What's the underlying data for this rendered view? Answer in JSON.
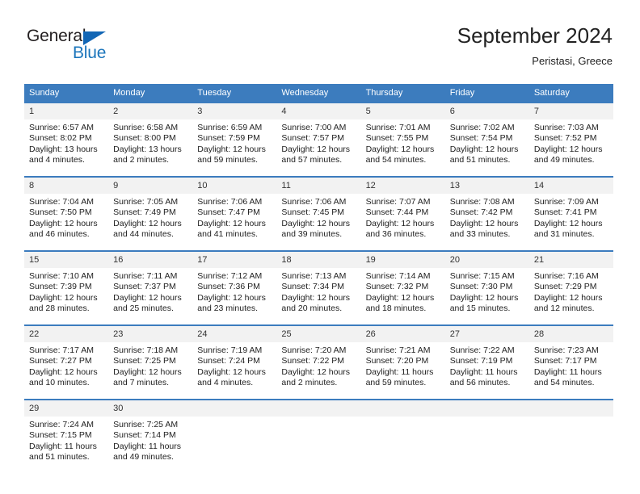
{
  "logo": {
    "word_one": "General",
    "word_two": "Blue",
    "triangle_color": "#1266b5",
    "blue_color": "#1b75bb"
  },
  "header": {
    "month_title": "September 2024",
    "location": "Peristasi, Greece"
  },
  "theme": {
    "header_blue": "#3c7cbe",
    "daynum_band": "#f2f2f2",
    "text": "#222222"
  },
  "weekday_headers": [
    "Sunday",
    "Monday",
    "Tuesday",
    "Wednesday",
    "Thursday",
    "Friday",
    "Saturday"
  ],
  "weeks": [
    [
      {
        "day": "1",
        "sunrise": "Sunrise: 6:57 AM",
        "sunset": "Sunset: 8:02 PM",
        "daylight_line1": "Daylight: 13 hours",
        "daylight_line2": "and 4 minutes."
      },
      {
        "day": "2",
        "sunrise": "Sunrise: 6:58 AM",
        "sunset": "Sunset: 8:00 PM",
        "daylight_line1": "Daylight: 13 hours",
        "daylight_line2": "and 2 minutes."
      },
      {
        "day": "3",
        "sunrise": "Sunrise: 6:59 AM",
        "sunset": "Sunset: 7:59 PM",
        "daylight_line1": "Daylight: 12 hours",
        "daylight_line2": "and 59 minutes."
      },
      {
        "day": "4",
        "sunrise": "Sunrise: 7:00 AM",
        "sunset": "Sunset: 7:57 PM",
        "daylight_line1": "Daylight: 12 hours",
        "daylight_line2": "and 57 minutes."
      },
      {
        "day": "5",
        "sunrise": "Sunrise: 7:01 AM",
        "sunset": "Sunset: 7:55 PM",
        "daylight_line1": "Daylight: 12 hours",
        "daylight_line2": "and 54 minutes."
      },
      {
        "day": "6",
        "sunrise": "Sunrise: 7:02 AM",
        "sunset": "Sunset: 7:54 PM",
        "daylight_line1": "Daylight: 12 hours",
        "daylight_line2": "and 51 minutes."
      },
      {
        "day": "7",
        "sunrise": "Sunrise: 7:03 AM",
        "sunset": "Sunset: 7:52 PM",
        "daylight_line1": "Daylight: 12 hours",
        "daylight_line2": "and 49 minutes."
      }
    ],
    [
      {
        "day": "8",
        "sunrise": "Sunrise: 7:04 AM",
        "sunset": "Sunset: 7:50 PM",
        "daylight_line1": "Daylight: 12 hours",
        "daylight_line2": "and 46 minutes."
      },
      {
        "day": "9",
        "sunrise": "Sunrise: 7:05 AM",
        "sunset": "Sunset: 7:49 PM",
        "daylight_line1": "Daylight: 12 hours",
        "daylight_line2": "and 44 minutes."
      },
      {
        "day": "10",
        "sunrise": "Sunrise: 7:06 AM",
        "sunset": "Sunset: 7:47 PM",
        "daylight_line1": "Daylight: 12 hours",
        "daylight_line2": "and 41 minutes."
      },
      {
        "day": "11",
        "sunrise": "Sunrise: 7:06 AM",
        "sunset": "Sunset: 7:45 PM",
        "daylight_line1": "Daylight: 12 hours",
        "daylight_line2": "and 39 minutes."
      },
      {
        "day": "12",
        "sunrise": "Sunrise: 7:07 AM",
        "sunset": "Sunset: 7:44 PM",
        "daylight_line1": "Daylight: 12 hours",
        "daylight_line2": "and 36 minutes."
      },
      {
        "day": "13",
        "sunrise": "Sunrise: 7:08 AM",
        "sunset": "Sunset: 7:42 PM",
        "daylight_line1": "Daylight: 12 hours",
        "daylight_line2": "and 33 minutes."
      },
      {
        "day": "14",
        "sunrise": "Sunrise: 7:09 AM",
        "sunset": "Sunset: 7:41 PM",
        "daylight_line1": "Daylight: 12 hours",
        "daylight_line2": "and 31 minutes."
      }
    ],
    [
      {
        "day": "15",
        "sunrise": "Sunrise: 7:10 AM",
        "sunset": "Sunset: 7:39 PM",
        "daylight_line1": "Daylight: 12 hours",
        "daylight_line2": "and 28 minutes."
      },
      {
        "day": "16",
        "sunrise": "Sunrise: 7:11 AM",
        "sunset": "Sunset: 7:37 PM",
        "daylight_line1": "Daylight: 12 hours",
        "daylight_line2": "and 25 minutes."
      },
      {
        "day": "17",
        "sunrise": "Sunrise: 7:12 AM",
        "sunset": "Sunset: 7:36 PM",
        "daylight_line1": "Daylight: 12 hours",
        "daylight_line2": "and 23 minutes."
      },
      {
        "day": "18",
        "sunrise": "Sunrise: 7:13 AM",
        "sunset": "Sunset: 7:34 PM",
        "daylight_line1": "Daylight: 12 hours",
        "daylight_line2": "and 20 minutes."
      },
      {
        "day": "19",
        "sunrise": "Sunrise: 7:14 AM",
        "sunset": "Sunset: 7:32 PM",
        "daylight_line1": "Daylight: 12 hours",
        "daylight_line2": "and 18 minutes."
      },
      {
        "day": "20",
        "sunrise": "Sunrise: 7:15 AM",
        "sunset": "Sunset: 7:30 PM",
        "daylight_line1": "Daylight: 12 hours",
        "daylight_line2": "and 15 minutes."
      },
      {
        "day": "21",
        "sunrise": "Sunrise: 7:16 AM",
        "sunset": "Sunset: 7:29 PM",
        "daylight_line1": "Daylight: 12 hours",
        "daylight_line2": "and 12 minutes."
      }
    ],
    [
      {
        "day": "22",
        "sunrise": "Sunrise: 7:17 AM",
        "sunset": "Sunset: 7:27 PM",
        "daylight_line1": "Daylight: 12 hours",
        "daylight_line2": "and 10 minutes."
      },
      {
        "day": "23",
        "sunrise": "Sunrise: 7:18 AM",
        "sunset": "Sunset: 7:25 PM",
        "daylight_line1": "Daylight: 12 hours",
        "daylight_line2": "and 7 minutes."
      },
      {
        "day": "24",
        "sunrise": "Sunrise: 7:19 AM",
        "sunset": "Sunset: 7:24 PM",
        "daylight_line1": "Daylight: 12 hours",
        "daylight_line2": "and 4 minutes."
      },
      {
        "day": "25",
        "sunrise": "Sunrise: 7:20 AM",
        "sunset": "Sunset: 7:22 PM",
        "daylight_line1": "Daylight: 12 hours",
        "daylight_line2": "and 2 minutes."
      },
      {
        "day": "26",
        "sunrise": "Sunrise: 7:21 AM",
        "sunset": "Sunset: 7:20 PM",
        "daylight_line1": "Daylight: 11 hours",
        "daylight_line2": "and 59 minutes."
      },
      {
        "day": "27",
        "sunrise": "Sunrise: 7:22 AM",
        "sunset": "Sunset: 7:19 PM",
        "daylight_line1": "Daylight: 11 hours",
        "daylight_line2": "and 56 minutes."
      },
      {
        "day": "28",
        "sunrise": "Sunrise: 7:23 AM",
        "sunset": "Sunset: 7:17 PM",
        "daylight_line1": "Daylight: 11 hours",
        "daylight_line2": "and 54 minutes."
      }
    ],
    [
      {
        "day": "29",
        "sunrise": "Sunrise: 7:24 AM",
        "sunset": "Sunset: 7:15 PM",
        "daylight_line1": "Daylight: 11 hours",
        "daylight_line2": "and 51 minutes."
      },
      {
        "day": "30",
        "sunrise": "Sunrise: 7:25 AM",
        "sunset": "Sunset: 7:14 PM",
        "daylight_line1": "Daylight: 11 hours",
        "daylight_line2": "and 49 minutes."
      },
      {
        "day": "",
        "sunrise": "",
        "sunset": "",
        "daylight_line1": "",
        "daylight_line2": ""
      },
      {
        "day": "",
        "sunrise": "",
        "sunset": "",
        "daylight_line1": "",
        "daylight_line2": ""
      },
      {
        "day": "",
        "sunrise": "",
        "sunset": "",
        "daylight_line1": "",
        "daylight_line2": ""
      },
      {
        "day": "",
        "sunrise": "",
        "sunset": "",
        "daylight_line1": "",
        "daylight_line2": ""
      },
      {
        "day": "",
        "sunrise": "",
        "sunset": "",
        "daylight_line1": "",
        "daylight_line2": ""
      }
    ]
  ]
}
